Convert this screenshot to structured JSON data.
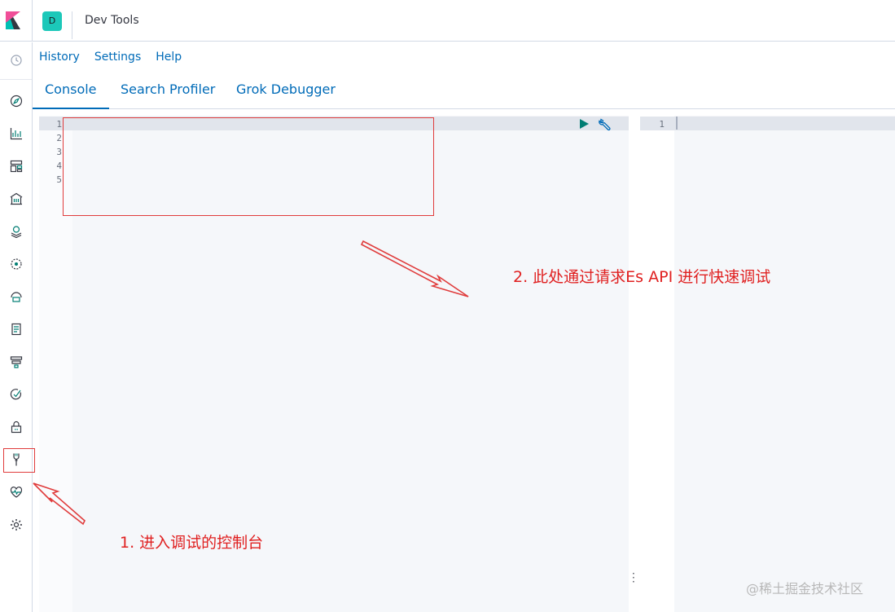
{
  "header": {
    "space_initial": "D",
    "app_title": "Dev Tools"
  },
  "nav": {
    "items": [
      {
        "icon": "clock-icon"
      },
      {
        "icon": "compass-icon"
      },
      {
        "icon": "visualize-icon"
      },
      {
        "icon": "dashboard-icon"
      },
      {
        "icon": "canvas-icon"
      },
      {
        "icon": "maps-icon"
      },
      {
        "icon": "ml-icon"
      },
      {
        "icon": "infrastructure-icon"
      },
      {
        "icon": "logs-icon"
      },
      {
        "icon": "apm-icon"
      },
      {
        "icon": "uptime-icon"
      },
      {
        "icon": "siem-icon"
      },
      {
        "icon": "dev-tools-icon"
      },
      {
        "icon": "monitoring-icon"
      },
      {
        "icon": "management-gear-icon"
      }
    ]
  },
  "menu": {
    "history": "History",
    "settings": "Settings",
    "help": "Help"
  },
  "tabs": {
    "console": "Console",
    "search_profiler": "Search Profiler",
    "grok_debugger": "Grok Debugger"
  },
  "editor": {
    "line_numbers": [
      "1",
      "2",
      "3",
      "4",
      "5"
    ],
    "response_line_numbers": [
      "1"
    ]
  },
  "annotations": {
    "note2": "2. 此处通过请求Es API 进行快速调试",
    "note1": "1. 进入调试的控制台",
    "color": "#e02020"
  },
  "watermark": "@稀土掘金技术社区",
  "colors": {
    "link": "#006bb8",
    "space_avatar": "#1cc8b9",
    "run_green": "#017d73"
  }
}
